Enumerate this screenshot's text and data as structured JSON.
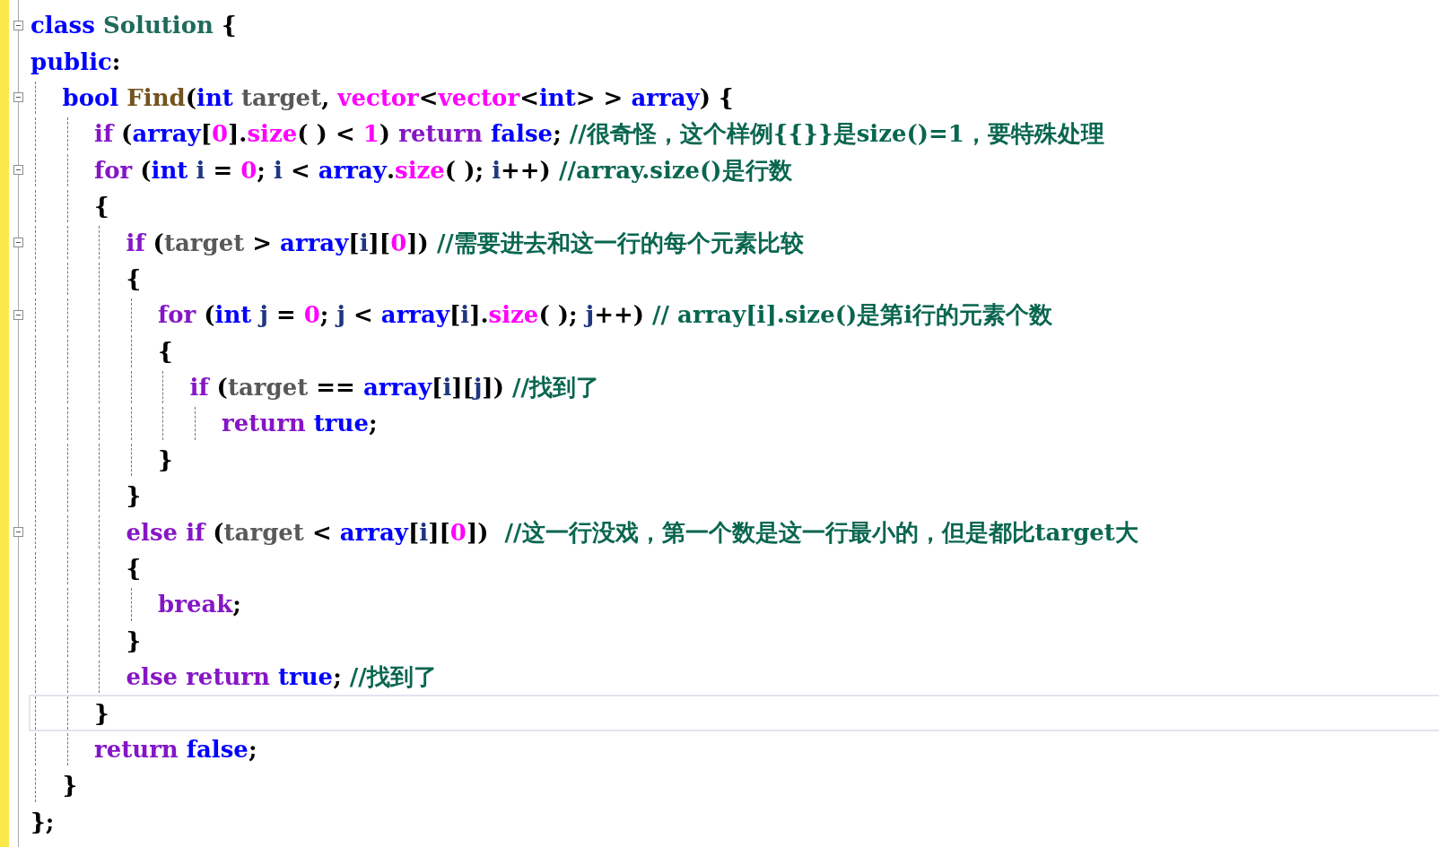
{
  "lines": [
    {
      "foldable": true,
      "current": false,
      "tokens": [
        {
          "kind": "type",
          "text": "class "
        },
        {
          "kind": "cls",
          "text": "Solution"
        },
        {
          "kind": "p",
          "text": " {"
        }
      ]
    },
    {
      "foldable": false,
      "current": false,
      "tokens": [
        {
          "kind": "type",
          "text": "public"
        },
        {
          "kind": "p",
          "text": ":"
        }
      ],
      "children": [
        {
          "foldable": true,
          "current": false,
          "tokens": [
            {
              "kind": "type",
              "text": "bool "
            },
            {
              "kind": "fn",
              "text": "Find"
            },
            {
              "kind": "p",
              "text": "("
            },
            {
              "kind": "type",
              "text": "int "
            },
            {
              "kind": "param",
              "text": "target"
            },
            {
              "kind": "p",
              "text": ", "
            },
            {
              "kind": "mac",
              "text": "vector"
            },
            {
              "kind": "p",
              "text": "<"
            },
            {
              "kind": "mac",
              "text": "vector"
            },
            {
              "kind": "p",
              "text": "<"
            },
            {
              "kind": "type",
              "text": "int"
            },
            {
              "kind": "p",
              "text": "> > "
            },
            {
              "kind": "type",
              "text": "array"
            },
            {
              "kind": "p",
              "text": ") {"
            }
          ],
          "children": [
            {
              "foldable": false,
              "current": false,
              "tokens": [
                {
                  "kind": "kw",
                  "text": "if"
                },
                {
                  "kind": "p",
                  "text": " ("
                },
                {
                  "kind": "type",
                  "text": "array"
                },
                {
                  "kind": "p",
                  "text": "["
                },
                {
                  "kind": "mac",
                  "text": "0"
                },
                {
                  "kind": "p",
                  "text": "]."
                },
                {
                  "kind": "mac",
                  "text": "size"
                },
                {
                  "kind": "p",
                  "text": "( ) < "
                },
                {
                  "kind": "mac",
                  "text": "1"
                },
                {
                  "kind": "p",
                  "text": ") "
                },
                {
                  "kind": "kw",
                  "text": "return "
                },
                {
                  "kind": "type",
                  "text": "false"
                },
                {
                  "kind": "p",
                  "text": "; "
                },
                {
                  "kind": "cm",
                  "text": "//很奇怪，这个样例{{}}是size()=1，要特殊处理"
                }
              ]
            },
            {
              "foldable": true,
              "current": false,
              "tokens": [
                {
                  "kind": "kw",
                  "text": "for"
                },
                {
                  "kind": "p",
                  "text": " ("
                },
                {
                  "kind": "type",
                  "text": "int "
                },
                {
                  "kind": "loc",
                  "text": "i"
                },
                {
                  "kind": "p",
                  "text": " = "
                },
                {
                  "kind": "mac",
                  "text": "0"
                },
                {
                  "kind": "p",
                  "text": "; "
                },
                {
                  "kind": "loc",
                  "text": "i"
                },
                {
                  "kind": "p",
                  "text": " < "
                },
                {
                  "kind": "type",
                  "text": "array"
                },
                {
                  "kind": "p",
                  "text": "."
                },
                {
                  "kind": "mac",
                  "text": "size"
                },
                {
                  "kind": "p",
                  "text": "( ); "
                },
                {
                  "kind": "loc",
                  "text": "i"
                },
                {
                  "kind": "p",
                  "text": "++) "
                },
                {
                  "kind": "cm",
                  "text": "//array.size()是行数"
                }
              ]
            },
            {
              "foldable": false,
              "current": false,
              "tokens": [
                {
                  "kind": "p",
                  "text": "{"
                }
              ],
              "children": [
                {
                  "foldable": true,
                  "current": false,
                  "tokens": [
                    {
                      "kind": "kw",
                      "text": "if"
                    },
                    {
                      "kind": "p",
                      "text": " ("
                    },
                    {
                      "kind": "param",
                      "text": "target"
                    },
                    {
                      "kind": "p",
                      "text": " > "
                    },
                    {
                      "kind": "type",
                      "text": "array"
                    },
                    {
                      "kind": "p",
                      "text": "["
                    },
                    {
                      "kind": "loc",
                      "text": "i"
                    },
                    {
                      "kind": "p",
                      "text": "]["
                    },
                    {
                      "kind": "mac",
                      "text": "0"
                    },
                    {
                      "kind": "p",
                      "text": "]) "
                    },
                    {
                      "kind": "cm",
                      "text": "//需要进去和这一行的每个元素比较"
                    }
                  ]
                },
                {
                  "foldable": false,
                  "current": false,
                  "tokens": [
                    {
                      "kind": "p",
                      "text": "{"
                    }
                  ],
                  "children": [
                    {
                      "foldable": true,
                      "current": false,
                      "tokens": [
                        {
                          "kind": "kw",
                          "text": "for"
                        },
                        {
                          "kind": "p",
                          "text": " ("
                        },
                        {
                          "kind": "type",
                          "text": "int "
                        },
                        {
                          "kind": "loc",
                          "text": "j"
                        },
                        {
                          "kind": "p",
                          "text": " = "
                        },
                        {
                          "kind": "mac",
                          "text": "0"
                        },
                        {
                          "kind": "p",
                          "text": "; "
                        },
                        {
                          "kind": "loc",
                          "text": "j"
                        },
                        {
                          "kind": "p",
                          "text": " < "
                        },
                        {
                          "kind": "type",
                          "text": "array"
                        },
                        {
                          "kind": "p",
                          "text": "["
                        },
                        {
                          "kind": "loc",
                          "text": "i"
                        },
                        {
                          "kind": "p",
                          "text": "]."
                        },
                        {
                          "kind": "mac",
                          "text": "size"
                        },
                        {
                          "kind": "p",
                          "text": "( ); "
                        },
                        {
                          "kind": "loc",
                          "text": "j"
                        },
                        {
                          "kind": "p",
                          "text": "++) "
                        },
                        {
                          "kind": "cm",
                          "text": "// array[i].size()是第i行的元素个数"
                        }
                      ]
                    },
                    {
                      "foldable": false,
                      "current": false,
                      "tokens": [
                        {
                          "kind": "p",
                          "text": "{"
                        }
                      ],
                      "children": [
                        {
                          "foldable": false,
                          "current": false,
                          "tokens": [
                            {
                              "kind": "kw",
                              "text": "if"
                            },
                            {
                              "kind": "p",
                              "text": " ("
                            },
                            {
                              "kind": "param",
                              "text": "target"
                            },
                            {
                              "kind": "p",
                              "text": " == "
                            },
                            {
                              "kind": "type",
                              "text": "array"
                            },
                            {
                              "kind": "p",
                              "text": "["
                            },
                            {
                              "kind": "loc",
                              "text": "i"
                            },
                            {
                              "kind": "p",
                              "text": "]["
                            },
                            {
                              "kind": "loc",
                              "text": "j"
                            },
                            {
                              "kind": "p",
                              "text": "]) "
                            },
                            {
                              "kind": "cm",
                              "text": "//找到了"
                            }
                          ],
                          "children": [
                            {
                              "foldable": false,
                              "current": false,
                              "tokens": [
                                {
                                  "kind": "kw",
                                  "text": "return "
                                },
                                {
                                  "kind": "type",
                                  "text": "true"
                                },
                                {
                                  "kind": "p",
                                  "text": ";"
                                }
                              ]
                            }
                          ]
                        }
                      ]
                    },
                    {
                      "foldable": false,
                      "current": false,
                      "tokens": [
                        {
                          "kind": "p",
                          "text": "}"
                        }
                      ]
                    }
                  ]
                },
                {
                  "foldable": false,
                  "current": false,
                  "tokens": [
                    {
                      "kind": "p",
                      "text": "}"
                    }
                  ]
                },
                {
                  "foldable": true,
                  "current": false,
                  "tokens": [
                    {
                      "kind": "kw",
                      "text": "else if"
                    },
                    {
                      "kind": "p",
                      "text": " ("
                    },
                    {
                      "kind": "param",
                      "text": "target"
                    },
                    {
                      "kind": "p",
                      "text": " < "
                    },
                    {
                      "kind": "type",
                      "text": "array"
                    },
                    {
                      "kind": "p",
                      "text": "["
                    },
                    {
                      "kind": "loc",
                      "text": "i"
                    },
                    {
                      "kind": "p",
                      "text": "]["
                    },
                    {
                      "kind": "mac",
                      "text": "0"
                    },
                    {
                      "kind": "p",
                      "text": "])  "
                    },
                    {
                      "kind": "cm",
                      "text": "//这一行没戏，第一个数是这一行最小的，但是都比target大"
                    }
                  ]
                },
                {
                  "foldable": false,
                  "current": false,
                  "tokens": [
                    {
                      "kind": "p",
                      "text": "{"
                    }
                  ],
                  "children": [
                    {
                      "foldable": false,
                      "current": false,
                      "tokens": [
                        {
                          "kind": "kw",
                          "text": "break"
                        },
                        {
                          "kind": "p",
                          "text": ";"
                        }
                      ]
                    }
                  ]
                },
                {
                  "foldable": false,
                  "current": false,
                  "tokens": [
                    {
                      "kind": "p",
                      "text": "}"
                    }
                  ]
                },
                {
                  "foldable": false,
                  "current": false,
                  "tokens": [
                    {
                      "kind": "kw",
                      "text": "else return "
                    },
                    {
                      "kind": "type",
                      "text": "true"
                    },
                    {
                      "kind": "p",
                      "text": "; "
                    },
                    {
                      "kind": "cm",
                      "text": "//找到了"
                    }
                  ]
                }
              ]
            },
            {
              "foldable": false,
              "current": true,
              "tokens": [
                {
                  "kind": "p",
                  "text": "}"
                }
              ]
            },
            {
              "foldable": false,
              "current": false,
              "tokens": [
                {
                  "kind": "kw",
                  "text": "return "
                },
                {
                  "kind": "type",
                  "text": "false"
                },
                {
                  "kind": "p",
                  "text": ";"
                }
              ]
            }
          ]
        },
        {
          "foldable": false,
          "current": false,
          "tokens": [
            {
              "kind": "p",
              "text": "}"
            }
          ]
        }
      ]
    },
    {
      "foldable": false,
      "current": false,
      "tokens": [
        {
          "kind": "p",
          "text": "};"
        }
      ]
    }
  ]
}
